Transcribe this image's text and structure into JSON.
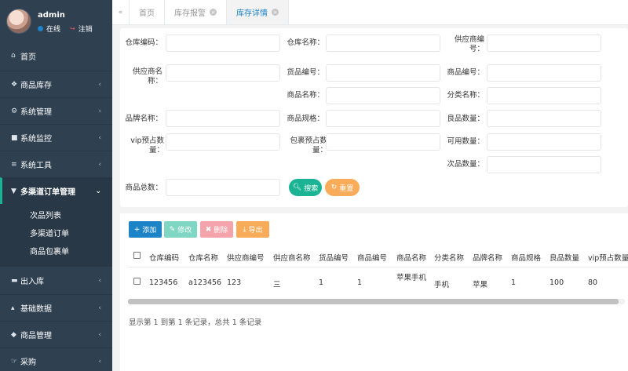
{
  "user": {
    "name": "admin",
    "status": "在线",
    "logout": "注销"
  },
  "sidebar": {
    "items": [
      {
        "label": "首页",
        "icon": "home-icon"
      },
      {
        "label": "商品库存",
        "icon": "cubes-icon"
      },
      {
        "label": "系统管理",
        "icon": "gear-icon"
      },
      {
        "label": "系统监控",
        "icon": "video-icon"
      },
      {
        "label": "系统工具",
        "icon": "bars-icon"
      },
      {
        "label": "多渠道订单管理",
        "icon": "cart-icon"
      },
      {
        "label": "出入库",
        "icon": "truck-icon"
      },
      {
        "label": "基础数据",
        "icon": "fire-icon"
      },
      {
        "label": "商品管理",
        "icon": "cube-icon"
      },
      {
        "label": "采购",
        "icon": "hand-icon"
      }
    ],
    "submenu": [
      "次品列表",
      "多渠道订单",
      "商品包裹单"
    ]
  },
  "tabs": [
    "首页",
    "库存报警",
    "库存详情"
  ],
  "search": {
    "labels": {
      "warehouse_code": "仓库编码：",
      "warehouse_name": "仓库名称：",
      "supplier_code": "供应商编号：",
      "supplier_name": "供应商名称：",
      "goods_no": "货品编号：",
      "product_no": "商品编号：",
      "product_name": "商品名称：",
      "category_name": "分类名称：",
      "brand_name": "品牌名称：",
      "product_spec": "商品规格：",
      "good_qty": "良品数量：",
      "vip_reserved": "vip预占数量：",
      "package_reserved": "包裹预占数量：",
      "available_qty": "可用数量：",
      "defective_qty": "次品数量：",
      "total_qty": "商品总数："
    },
    "search_button": "搜索",
    "reset_button": "重置"
  },
  "toolbar": {
    "add": "添加",
    "edit": "修改",
    "delete": "删除",
    "export": "导出"
  },
  "table": {
    "columns": [
      "仓库编码",
      "仓库名称",
      "供应商编号",
      "供应商名称",
      "货品编号",
      "商品编号",
      "商品名称",
      "分类名称",
      "品牌名称",
      "商品规格",
      "良品数量",
      "vip预占数量"
    ],
    "rows": [
      [
        "123456",
        "a123456",
        "123",
        "三",
        "1",
        "1",
        "苹果手机",
        "手机",
        "苹果",
        "1",
        "100",
        "80"
      ]
    ],
    "summary": "显示第 1 到第 1 条记录，总共 1 条记录"
  },
  "colors": {
    "sidebar_bg": "#2f4050",
    "primary": "#1c84c6",
    "teal": "#1ab394",
    "warning": "#f8ac59",
    "danger": "#ed5565"
  }
}
